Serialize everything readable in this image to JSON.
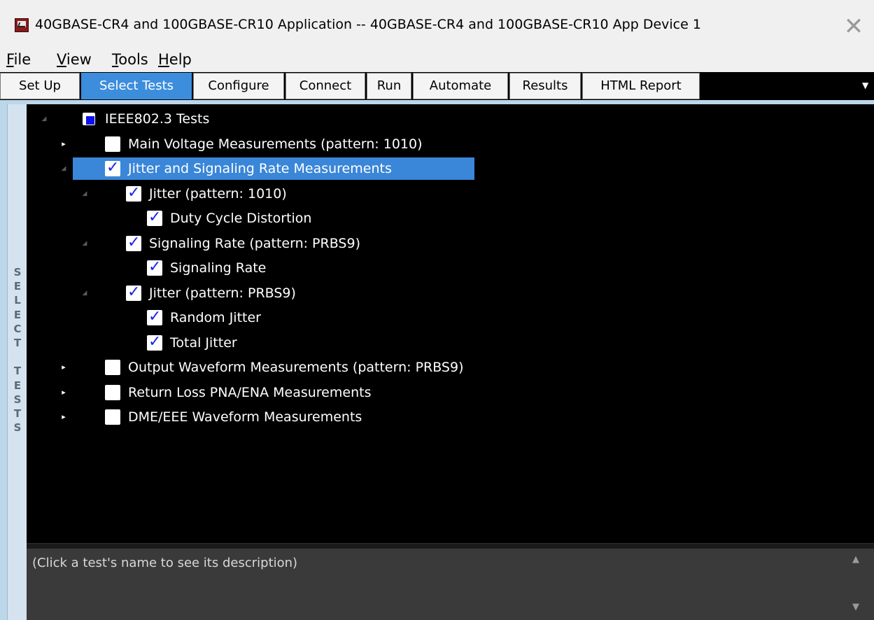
{
  "window": {
    "title": "40GBASE-CR4 and 100GBASE-CR10 Application -- 40GBASE-CR4 and 100GBASE-CR10 App Device 1",
    "close_glyph": "✕"
  },
  "menu": [
    {
      "label": "File",
      "accel": "F",
      "rest": "ile"
    },
    {
      "label": "View",
      "accel": "V",
      "rest": "iew"
    },
    {
      "label": "Tools",
      "accel": "T",
      "rest": "ools"
    },
    {
      "label": "Help",
      "accel": "H",
      "rest": "elp"
    }
  ],
  "tabs": [
    {
      "label": "Set Up",
      "active": false
    },
    {
      "label": "Select Tests",
      "active": true
    },
    {
      "label": "Configure",
      "active": false
    },
    {
      "label": "Connect",
      "active": false
    },
    {
      "label": "Run",
      "active": false
    },
    {
      "label": "Automate",
      "active": false
    },
    {
      "label": "Results",
      "active": false
    },
    {
      "label": "HTML Report",
      "active": false
    }
  ],
  "sidebar": {
    "label": "SELECT TESTS"
  },
  "tree": [
    {
      "label": "IEEE802.3 Tests",
      "level": 0,
      "state": "partial",
      "expander": "expanded",
      "selected": false
    },
    {
      "label": "Main Voltage Measurements (pattern: 1010)",
      "level": 1,
      "state": "unchecked",
      "expander": "collapsed",
      "selected": false
    },
    {
      "label": "Jitter and Signaling Rate Measurements",
      "level": 1,
      "state": "checked",
      "expander": "expanded",
      "selected": true
    },
    {
      "label": "Jitter (pattern: 1010)",
      "level": 2,
      "state": "checked",
      "expander": "expanded",
      "selected": false
    },
    {
      "label": "Duty Cycle Distortion",
      "level": 3,
      "state": "checked",
      "expander": "none",
      "selected": false
    },
    {
      "label": "Signaling Rate (pattern: PRBS9)",
      "level": 2,
      "state": "checked",
      "expander": "expanded",
      "selected": false
    },
    {
      "label": "Signaling Rate",
      "level": 3,
      "state": "checked",
      "expander": "none",
      "selected": false
    },
    {
      "label": "Jitter (pattern: PRBS9)",
      "level": 2,
      "state": "checked",
      "expander": "expanded",
      "selected": false
    },
    {
      "label": "Random Jitter",
      "level": 3,
      "state": "checked",
      "expander": "none",
      "selected": false
    },
    {
      "label": "Total Jitter",
      "level": 3,
      "state": "checked",
      "expander": "none",
      "selected": false
    },
    {
      "label": "Output Waveform Measurements (pattern: PRBS9)",
      "level": 1,
      "state": "unchecked",
      "expander": "collapsed",
      "selected": false
    },
    {
      "label": "Return Loss PNA/ENA Measurements",
      "level": 1,
      "state": "unchecked",
      "expander": "collapsed",
      "selected": false
    },
    {
      "label": "DME/EEE Waveform Measurements",
      "level": 1,
      "state": "unchecked",
      "expander": "collapsed",
      "selected": false
    }
  ],
  "description": {
    "text": "(Click a test's name to see its description)"
  },
  "colors": {
    "selection": "#3a86d8",
    "active_tab": "#3c8ddc",
    "check": "#1a24e8",
    "partial": "#1010ee"
  }
}
